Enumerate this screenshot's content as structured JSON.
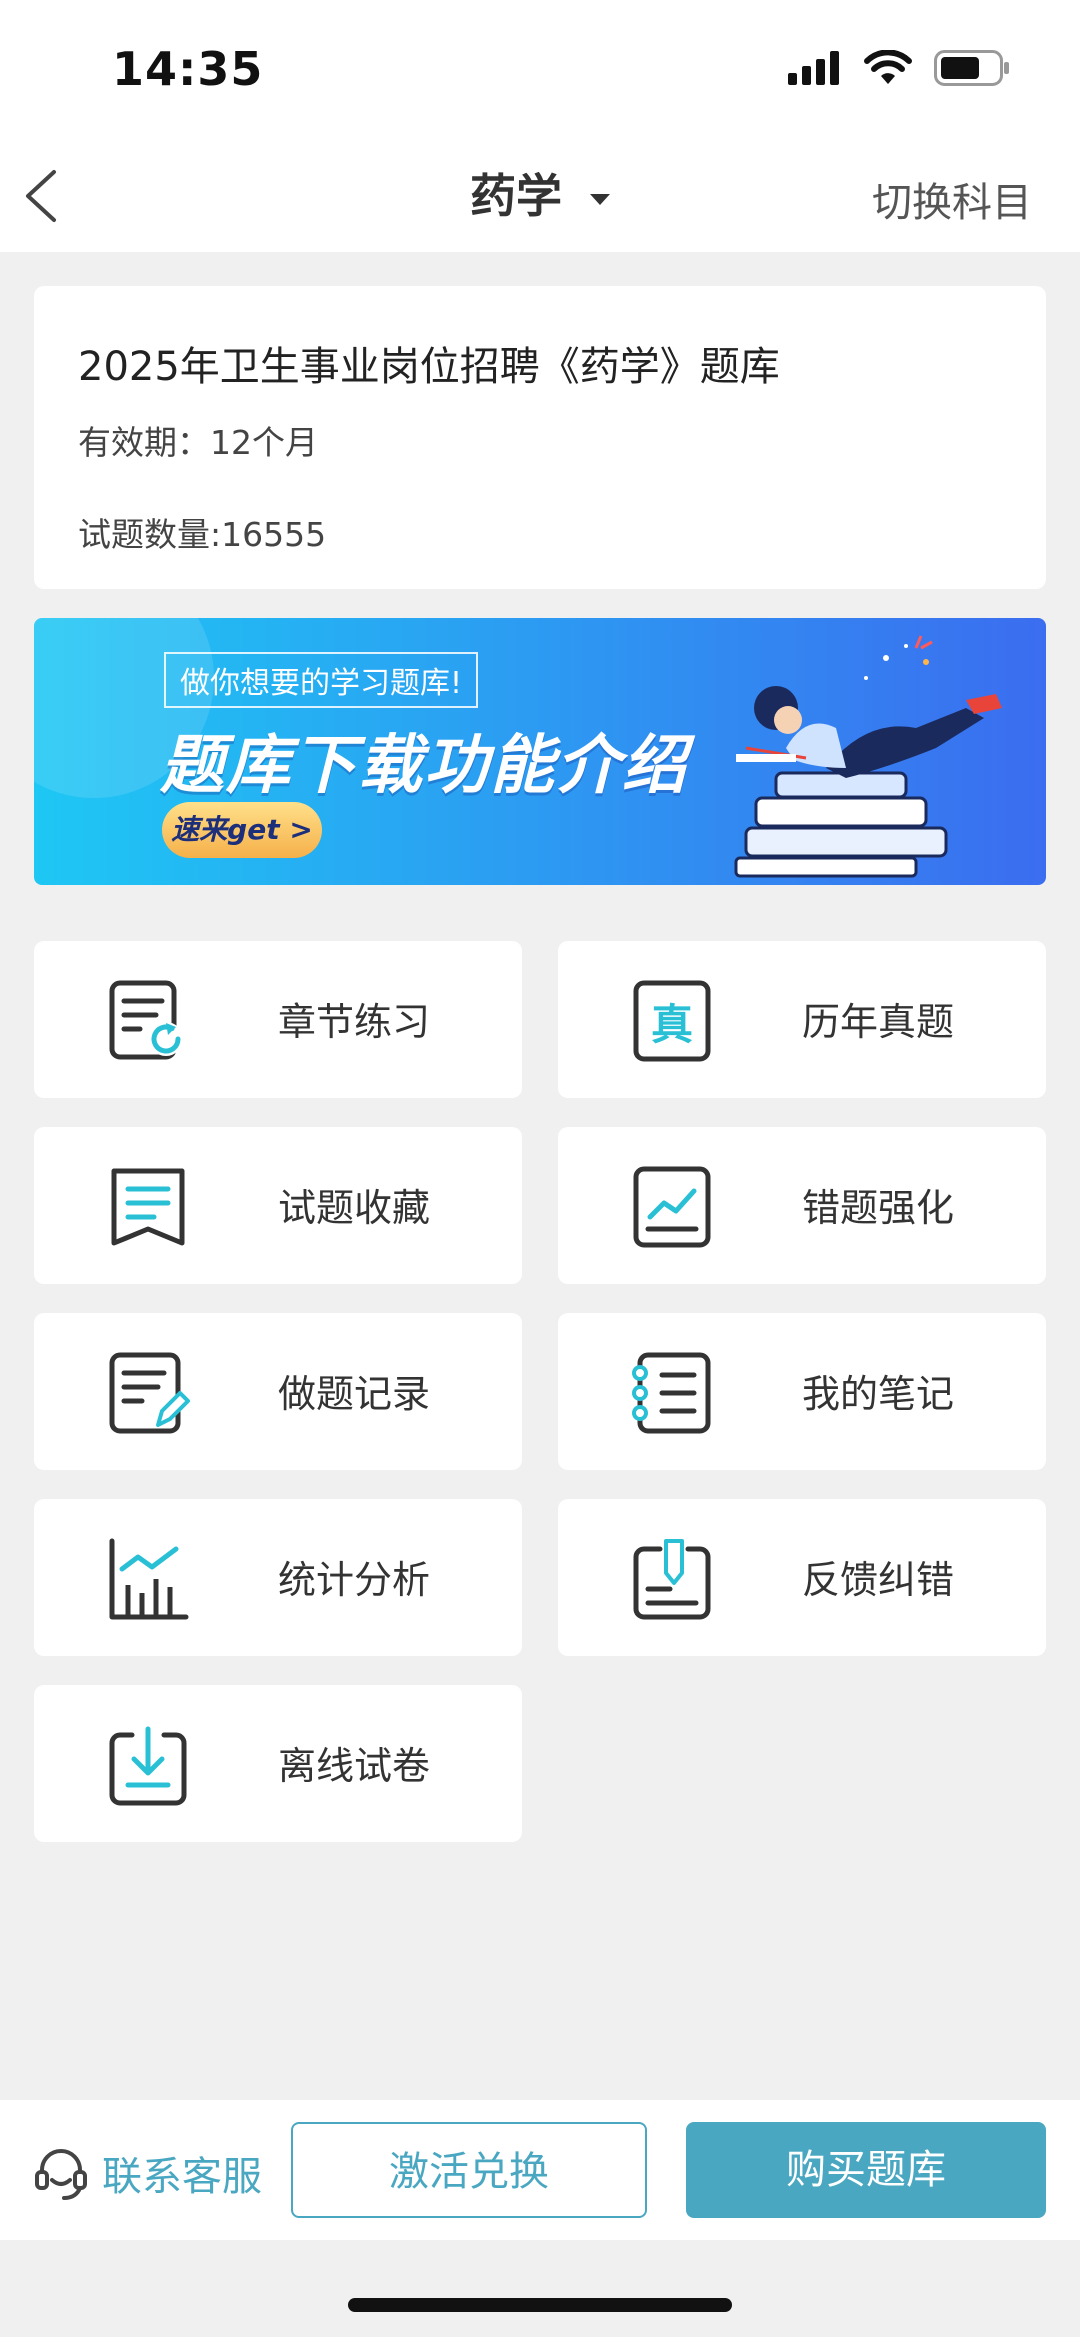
{
  "status_bar": {
    "time": "14:35",
    "icons": [
      "signal-icon",
      "wifi-icon",
      "battery-icon"
    ]
  },
  "nav": {
    "title": "药学",
    "switch_label": "切换科目"
  },
  "info_card": {
    "title": "2025年卫生事业岗位招聘《药学》题库",
    "validity": "有效期：12个月",
    "count": "试题数量:16555"
  },
  "banner": {
    "tag": "做你想要的学习题库!",
    "title": "题库下载功能介绍",
    "cta": "速来get >"
  },
  "grid": {
    "items": [
      {
        "label": "章节练习",
        "icon": "chapter-practice-icon"
      },
      {
        "label": "历年真题",
        "icon": "past-exam-icon"
      },
      {
        "label": "试题收藏",
        "icon": "bookmark-icon"
      },
      {
        "label": "错题强化",
        "icon": "wrong-question-icon"
      },
      {
        "label": "做题记录",
        "icon": "practice-record-icon"
      },
      {
        "label": "我的笔记",
        "icon": "notebook-icon"
      },
      {
        "label": "统计分析",
        "icon": "statistics-icon"
      },
      {
        "label": "反馈纠错",
        "icon": "feedback-icon"
      },
      {
        "label": "离线试卷",
        "icon": "offline-download-icon"
      }
    ]
  },
  "bottom_bar": {
    "service_label": "联系客服",
    "activate_label": "激活兑换",
    "buy_label": "购买题库"
  },
  "colors": {
    "accent": "#4aa7c2",
    "icon_teal": "#29c0d6",
    "icon_dark": "#333333"
  }
}
